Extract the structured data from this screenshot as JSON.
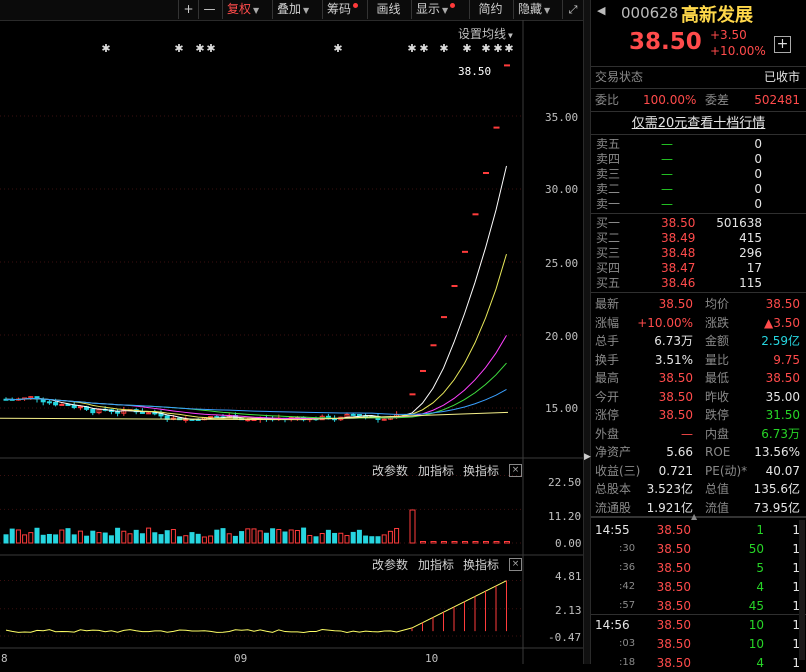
{
  "toolbar": {
    "plus": "+",
    "minus": "—",
    "fuquan": "复权",
    "diejia": "叠加",
    "chouma": "筹码",
    "huaxian": "画线",
    "xianshi": "显示",
    "jianyue": "简约",
    "yincang": "隐藏"
  },
  "chart": {
    "ma_setting": "设置均线",
    "last_price_tag": "38.50",
    "price_axis": [
      "35.00",
      "30.00",
      "25.00",
      "20.00",
      "15.00"
    ],
    "vol_axis": [
      "22.50",
      "11.20",
      "0.00"
    ],
    "ind_axis": [
      "4.81",
      "2.13",
      "-0.47"
    ],
    "x_axis": [
      "8",
      "09",
      "10"
    ],
    "vol_buttons": {
      "params": "改参数",
      "add": "加指标",
      "switch": "换指标",
      "close": "×"
    },
    "ind_buttons": {
      "params": "改参数",
      "add": "加指标",
      "switch": "换指标",
      "close": "×"
    },
    "colors": {
      "up": "#ff3c3c",
      "down": "#27d6e0",
      "ma5": "#ffffff",
      "ma10": "#e8e85a",
      "ma20": "#ff40ff",
      "ma30": "#40e040",
      "ma60": "#3aa0ff"
    }
  },
  "chart_data": {
    "type": "candlestick",
    "price_ticks": [
      35.0,
      30.0,
      25.0,
      20.0,
      15.0
    ],
    "last_price": 38.5,
    "limit_up_days": [
      15.97,
      17.57,
      19.33,
      21.26,
      23.39,
      25.73,
      28.3,
      31.13,
      34.24,
      38.5
    ],
    "vol_ticks": [
      22.5,
      11.2,
      0.0
    ],
    "ind_ticks": [
      4.81,
      2.13,
      -0.47
    ],
    "x_ticks": [
      "8",
      "09",
      "10"
    ]
  },
  "panel": {
    "code": "000628",
    "name": "高新发展",
    "price": "38.50",
    "change": "+3.50",
    "change_pct": "+10.00%",
    "add_icon": "+",
    "status_label": "交易状态",
    "status_value": "已收市",
    "weibi_label": "委比",
    "weibi_value": "100.00%",
    "weicha_label": "委差",
    "weicha_value": "502481",
    "promo": "仅需20元查看十档行情",
    "sells": [
      {
        "label": "卖五",
        "price": "—",
        "vol": "0"
      },
      {
        "label": "卖四",
        "price": "—",
        "vol": "0"
      },
      {
        "label": "卖三",
        "price": "—",
        "vol": "0"
      },
      {
        "label": "卖二",
        "price": "—",
        "vol": "0"
      },
      {
        "label": "卖一",
        "price": "—",
        "vol": "0"
      }
    ],
    "buys": [
      {
        "label": "买一",
        "price": "38.50",
        "vol": "501638"
      },
      {
        "label": "买二",
        "price": "38.49",
        "vol": "415"
      },
      {
        "label": "买三",
        "price": "38.48",
        "vol": "296"
      },
      {
        "label": "买四",
        "price": "38.47",
        "vol": "17"
      },
      {
        "label": "买五",
        "price": "38.46",
        "vol": "115"
      }
    ],
    "stats": [
      {
        "l1": "最新",
        "v1": "38.50",
        "c1": "red",
        "l2": "均价",
        "v2": "38.50",
        "c2": "red"
      },
      {
        "l1": "涨幅",
        "v1": "+10.00%",
        "c1": "red",
        "l2": "涨跌",
        "v2": "▲3.50",
        "c2": "red"
      },
      {
        "l1": "总手",
        "v1": "6.73万",
        "c1": "white",
        "l2": "金额",
        "v2": "2.59亿",
        "c2": "cyan"
      },
      {
        "l1": "换手",
        "v1": "3.51%",
        "c1": "white",
        "l2": "量比",
        "v2": "9.75",
        "c2": "red"
      },
      {
        "l1": "最高",
        "v1": "38.50",
        "c1": "red",
        "l2": "最低",
        "v2": "38.50",
        "c2": "red"
      },
      {
        "l1": "今开",
        "v1": "38.50",
        "c1": "red",
        "l2": "昨收",
        "v2": "35.00",
        "c2": "white"
      },
      {
        "l1": "涨停",
        "v1": "38.50",
        "c1": "red",
        "l2": "跌停",
        "v2": "31.50",
        "c2": "green"
      },
      {
        "l1": "外盘",
        "v1": "—",
        "c1": "red",
        "l2": "内盘",
        "v2": "6.73万",
        "c2": "green"
      },
      {
        "l1": "净资产",
        "v1": "5.66",
        "c1": "white",
        "l2": "ROE",
        "v2": "13.56%",
        "c2": "white"
      },
      {
        "l1": "收益(三)",
        "v1": "0.721",
        "c1": "white",
        "l2": "PE(动)*",
        "v2": "40.07",
        "c2": "white"
      },
      {
        "l1": "总股本",
        "v1": "3.523亿",
        "c1": "white",
        "l2": "总值",
        "v2": "135.6亿",
        "c2": "white"
      },
      {
        "l1": "流通股",
        "v1": "1.921亿",
        "c1": "white",
        "l2": "流值",
        "v2": "73.95亿",
        "c2": "white"
      }
    ],
    "ticks": [
      {
        "time": "14:55",
        "price": "38.50",
        "vol": "1",
        "n": "1"
      },
      {
        "time": ":30",
        "price": "38.50",
        "vol": "50",
        "n": "1"
      },
      {
        "time": ":36",
        "price": "38.50",
        "vol": "5",
        "n": "1"
      },
      {
        "time": ":42",
        "price": "38.50",
        "vol": "4",
        "n": "1"
      },
      {
        "time": ":57",
        "price": "38.50",
        "vol": "45",
        "n": "1"
      },
      {
        "time": "14:56",
        "price": "38.50",
        "vol": "10",
        "n": "1"
      },
      {
        "time": ":03",
        "price": "38.50",
        "vol": "10",
        "n": "1"
      },
      {
        "time": ":18",
        "price": "38.50",
        "vol": "4",
        "n": "1"
      }
    ]
  }
}
